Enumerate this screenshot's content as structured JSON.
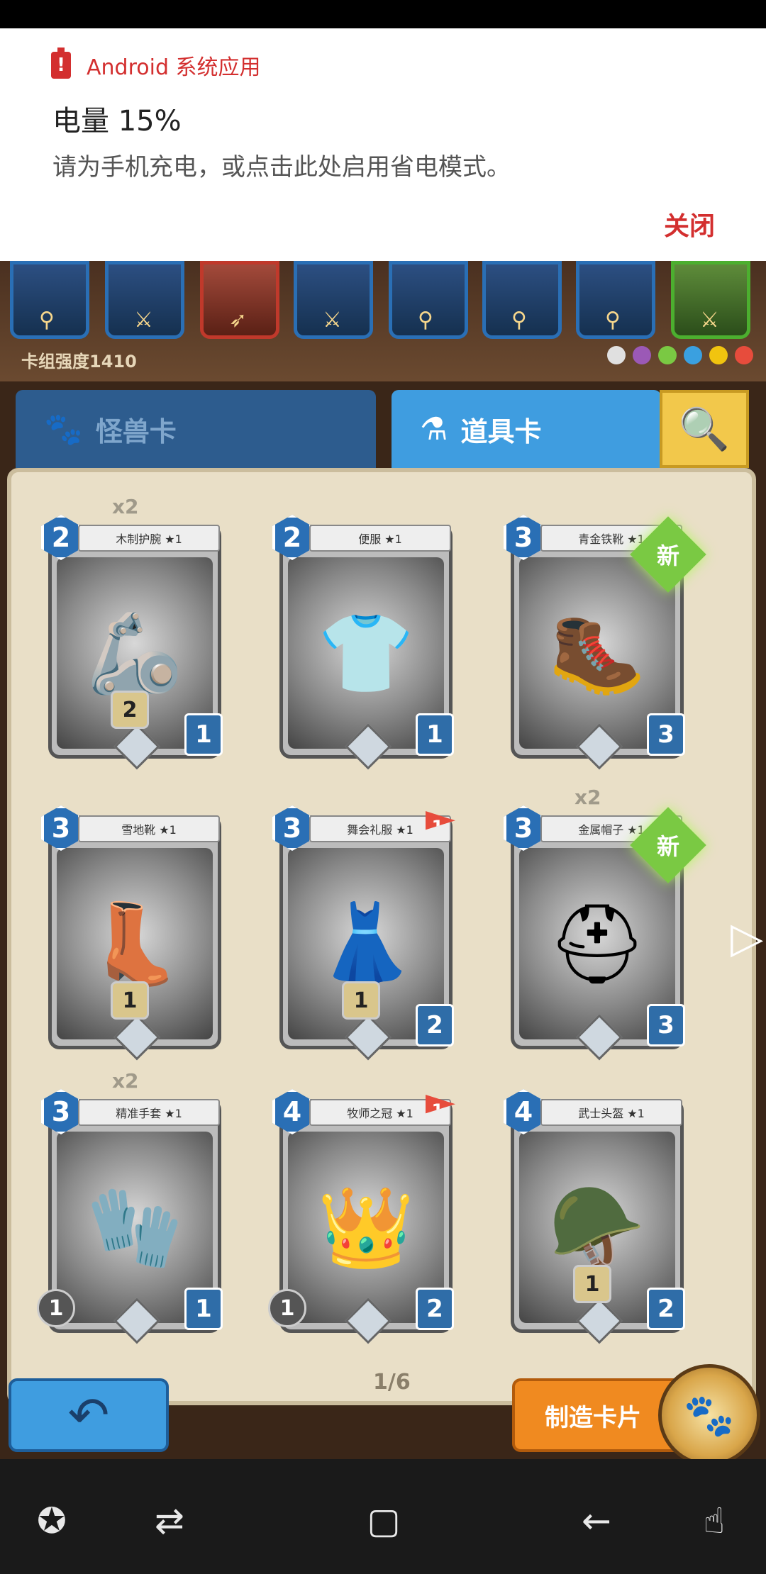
{
  "notification": {
    "app_name": "Android 系统应用",
    "title": "电量 15%",
    "body": "请为手机充电，或点击此处启用省电模式。",
    "close_label": "关闭"
  },
  "deck": {
    "power_label": "卡组强度1410",
    "elements": [
      {
        "name": "neutral",
        "color": "#e0e0e0"
      },
      {
        "name": "arcane",
        "color": "#9b59b6"
      },
      {
        "name": "nature",
        "color": "#7ac943"
      },
      {
        "name": "water",
        "color": "#3aa0e0"
      },
      {
        "name": "lightning",
        "color": "#f1c40f"
      },
      {
        "name": "fire",
        "color": "#e74c3c"
      }
    ]
  },
  "tabs": {
    "monster": "怪兽卡",
    "item": "道具卡"
  },
  "cards": [
    {
      "name": "木制护腕 ★1",
      "cost": "2",
      "hp": "1",
      "multi": "x2",
      "level": "2",
      "icon": "🦾"
    },
    {
      "name": "便服 ★1",
      "cost": "2",
      "hp": "1",
      "icon": "👕"
    },
    {
      "name": "青金铁靴 ★1",
      "cost": "3",
      "hp": "3",
      "new": "新",
      "icon": "🥾"
    },
    {
      "name": "雪地靴 ★1",
      "cost": "3",
      "hp": "",
      "level": "1",
      "icon": "👢"
    },
    {
      "name": "舞会礼服 ★1",
      "cost": "3",
      "hp": "2",
      "flag": "1",
      "level": "1",
      "icon": "👗"
    },
    {
      "name": "金属帽子 ★1",
      "cost": "3",
      "hp": "3",
      "multi": "x2",
      "new": "新",
      "icon": "⛑"
    },
    {
      "name": "精准手套 ★1",
      "cost": "3",
      "hp": "1",
      "multi": "x2",
      "lvl_left": "1",
      "icon": "🧤"
    },
    {
      "name": "牧师之冠 ★1",
      "cost": "4",
      "hp": "2",
      "flag": "1",
      "lvl_left": "1",
      "icon": "👑"
    },
    {
      "name": "武士头盔 ★1",
      "cost": "4",
      "hp": "2",
      "level": "1",
      "icon": "🪖"
    }
  ],
  "page_indicator": "1/6",
  "buttons": {
    "craft_label": "制造卡片"
  },
  "navbar": [
    "game-tools-icon",
    "recent-apps-icon",
    "home-icon",
    "back-icon",
    "gesture-icon"
  ]
}
